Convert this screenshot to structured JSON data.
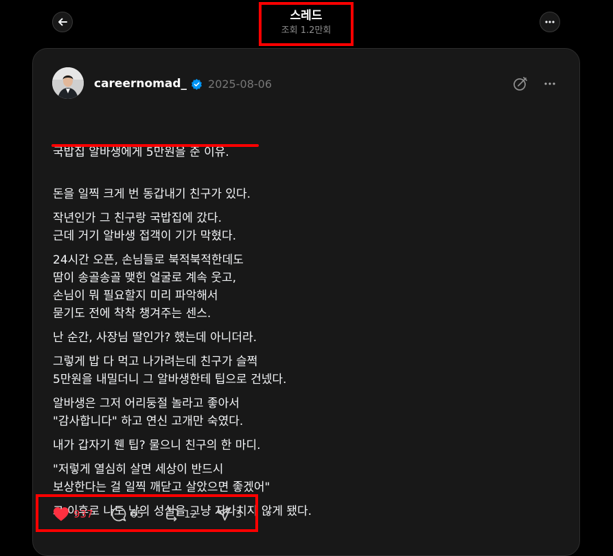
{
  "header": {
    "title": "스레드",
    "views": "조회 1.2만회"
  },
  "post": {
    "username": "careernomad_",
    "date": "2025-08-06",
    "paragraphs": [
      "국밥집 알바생에게 5만원을 준 이유.",
      "돈을 일찍 크게 번 동갑내기 친구가 있다.",
      "작년인가 그 친구랑 국밥집에 갔다.\n근데 거기 알바생 접객이 기가 막혔다.",
      "24시간 오픈, 손님들로 북적북적한데도\n땀이 송골송골 맺힌 얼굴로 계속 웃고,\n손님이 뭐 필요할지 미리 파악해서\n묻기도 전에 착착 챙겨주는 센스.",
      "난 순간, 사장님 딸인가? 했는데 아니더라.",
      "그렇게 밥 다 먹고 나가려는데 친구가 슬쩍\n5만원을 내밀더니 그 알바생한테 팁으로 건넸다.",
      "알바생은 그저 어리둥절 놀라고 좋아서\n\"감사합니다\" 하고 연신 고개만 숙였다.",
      "내가 갑자기 웬 팁? 물으니 친구의 한 마디.",
      "\"저렇게 열심히 살면 세상이 반드시\n보상한다는 걸 일찍 깨닫고 살았으면 좋겠어\"",
      "그 이후로 나도 남의 성실을 그냥 지나치지 않게 됐다."
    ]
  },
  "actions": {
    "likes": "937",
    "comments": "65",
    "reposts": "12",
    "shares": "3"
  },
  "icons": {
    "back": "back-arrow-icon",
    "more": "more-icon",
    "verified": "verified-badge-icon",
    "note": "note-icon",
    "like": "heart-icon",
    "comment": "comment-icon",
    "repost": "repost-icon",
    "share": "share-icon"
  },
  "colors": {
    "background": "#000000",
    "card": "#181818",
    "highlight": "#ff0000",
    "like": "#ff3040",
    "verified": "#0095f6"
  }
}
